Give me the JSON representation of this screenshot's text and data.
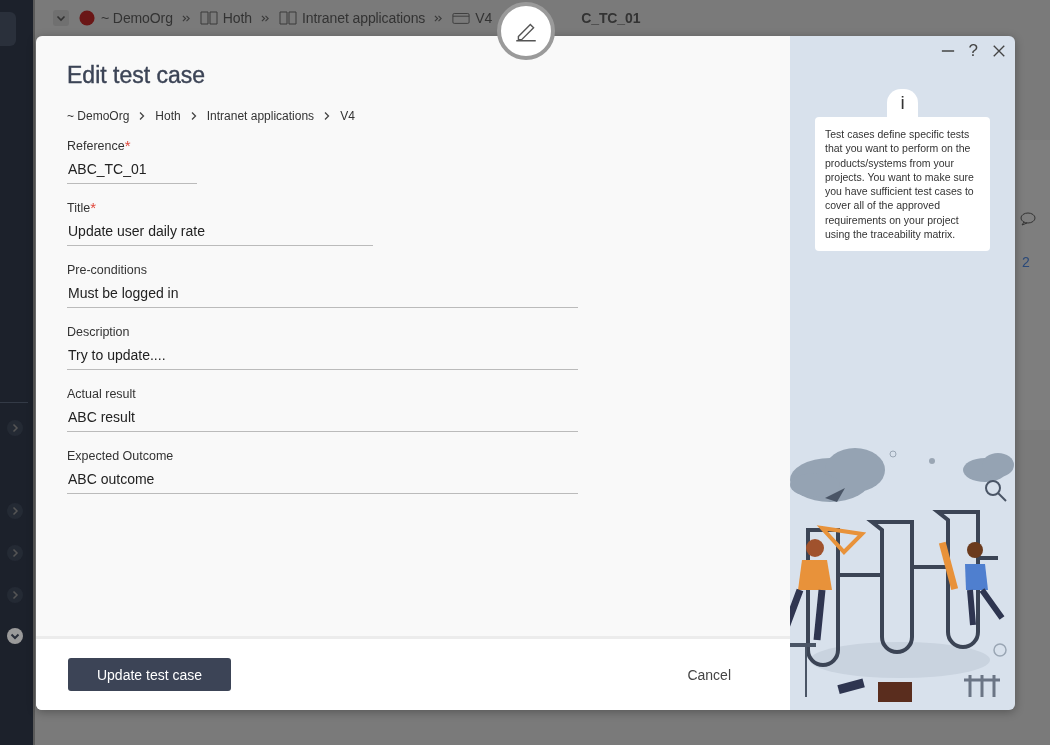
{
  "background": {
    "breadcrumb": [
      {
        "kind": "org",
        "label": "~ DemoOrg"
      },
      {
        "kind": "folder",
        "label": "Hoth"
      },
      {
        "kind": "folder",
        "label": "Intranet applications"
      },
      {
        "kind": "version",
        "label": "V4"
      },
      {
        "kind": "item",
        "label": "C_TC_01"
      }
    ],
    "count": "2"
  },
  "dialog": {
    "title": "Edit test case",
    "breadcrumb": [
      "~ DemoOrg",
      "Hoth",
      "Intranet applications",
      "V4"
    ],
    "fields": [
      {
        "label": "Reference",
        "required_mark": "*",
        "value": "ABC_TC_01"
      },
      {
        "label": "Title",
        "required_mark": "*",
        "value": "Update user daily rate"
      },
      {
        "label": "Pre-conditions",
        "value": "Must be logged in"
      },
      {
        "label": "Description",
        "value": "Try to update...."
      },
      {
        "label": "Actual result",
        "value": "ABC result"
      },
      {
        "label": "Expected Outcome",
        "value": "ABC outcome"
      }
    ],
    "primary_button": "Update test case",
    "cancel_button": "Cancel"
  },
  "side_panel": {
    "help": "?",
    "info_mark": "i",
    "info_text": "Test cases define specific tests that you want to perform on the products/systems from your projects. You want to make sure you have sufficient test cases to cover all of the approved requirements on your project using the traceability matrix."
  }
}
